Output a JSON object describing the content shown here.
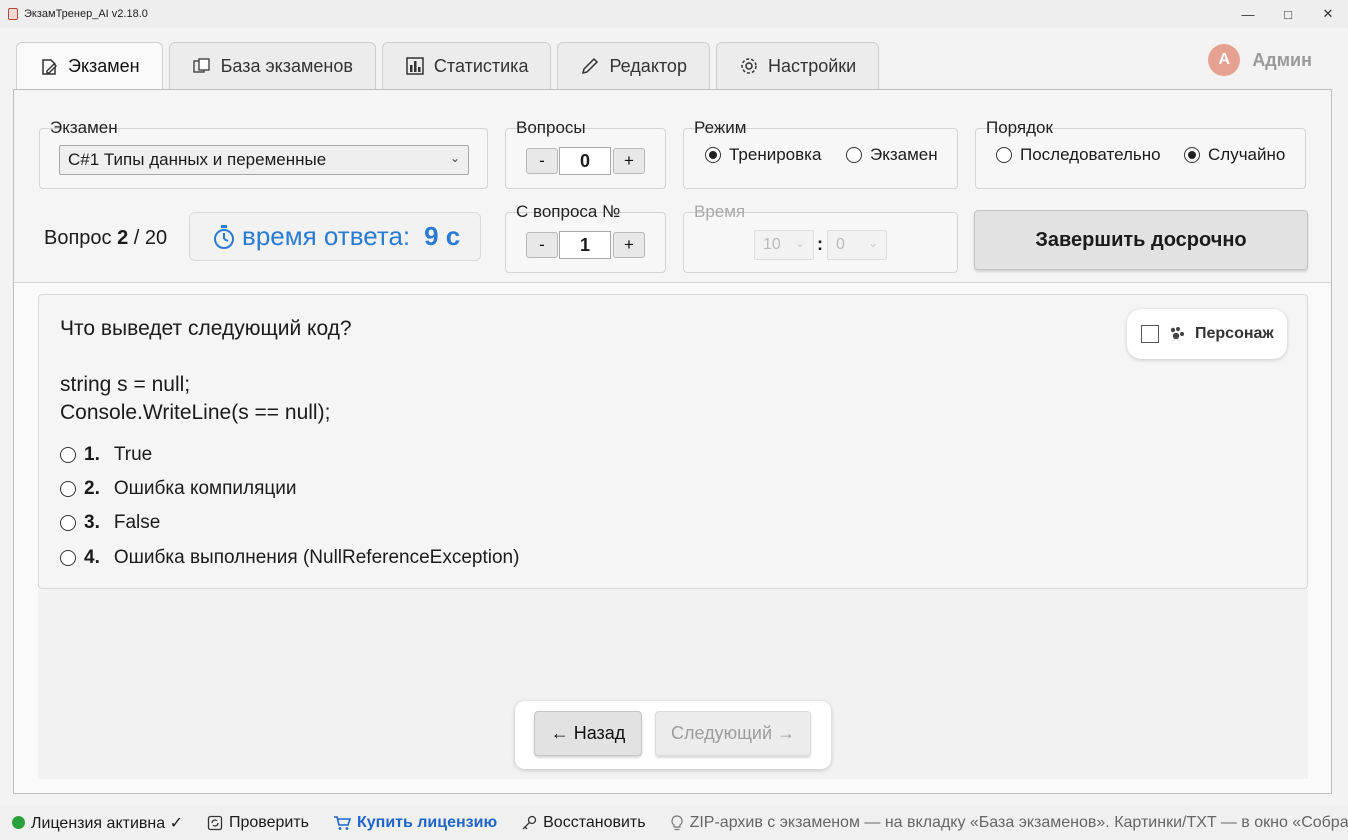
{
  "window": {
    "title": "ЭкзамТренер_AI v2.18.0"
  },
  "tabs": [
    {
      "label": "Экзамен",
      "icon": "document-edit-icon"
    },
    {
      "label": "База экзаменов",
      "icon": "copy-icon"
    },
    {
      "label": "Статистика",
      "icon": "bar-chart-icon"
    },
    {
      "label": "Редактор",
      "icon": "pencil-icon"
    },
    {
      "label": "Настройки",
      "icon": "gear-icon"
    }
  ],
  "user": {
    "initial": "A",
    "name": "Админ"
  },
  "exam": {
    "label": "Экзамен",
    "selected": "C#1 Типы данных и переменные"
  },
  "questions": {
    "label": "Вопросы",
    "value": "0",
    "minus": "-",
    "plus": "+"
  },
  "mode": {
    "label": "Режим",
    "options": [
      "Тренировка",
      "Экзамен"
    ],
    "selected": "Тренировка"
  },
  "order": {
    "label": "Порядок",
    "options": [
      "Последовательно",
      "Случайно"
    ],
    "selected": "Случайно"
  },
  "counter": {
    "prefix": "Вопрос",
    "current": "2",
    "separator": "/",
    "total": "20"
  },
  "timer": {
    "label": "время ответа:",
    "value": "9 с"
  },
  "from_question": {
    "label": "С вопроса №",
    "value": "1",
    "minus": "-",
    "plus": "+"
  },
  "time": {
    "label": "Время",
    "minutes": "10",
    "separator": ":",
    "seconds": "0"
  },
  "finish_button": "Завершить досрочно",
  "question": {
    "text": "Что выведет следующий код?\n\nstring s = null;\nConsole.WriteLine(s == null);",
    "answers": [
      {
        "num": "1.",
        "text": "True"
      },
      {
        "num": "2.",
        "text": "Ошибка компиляции"
      },
      {
        "num": "3.",
        "text": "False"
      },
      {
        "num": "4.",
        "text": "Ошибка выполнения (NullReferenceException)"
      }
    ]
  },
  "persona": {
    "label": "Персонаж"
  },
  "nav": {
    "back": "← Назад",
    "next": "Следующий →"
  },
  "status": {
    "license": "Лицензия активна ✓",
    "check": "Проверить",
    "buy": "Купить лицензию",
    "restore": "Восстановить",
    "hint": "ZIP-архив с экзаменом — на вкладку «База экзаменов». Картинки/TXT — в окно «Собрать экзаме"
  },
  "colors": {
    "accent": "#2a7bd4",
    "license_ok": "#2aa13c",
    "avatar": "#e6a192"
  }
}
